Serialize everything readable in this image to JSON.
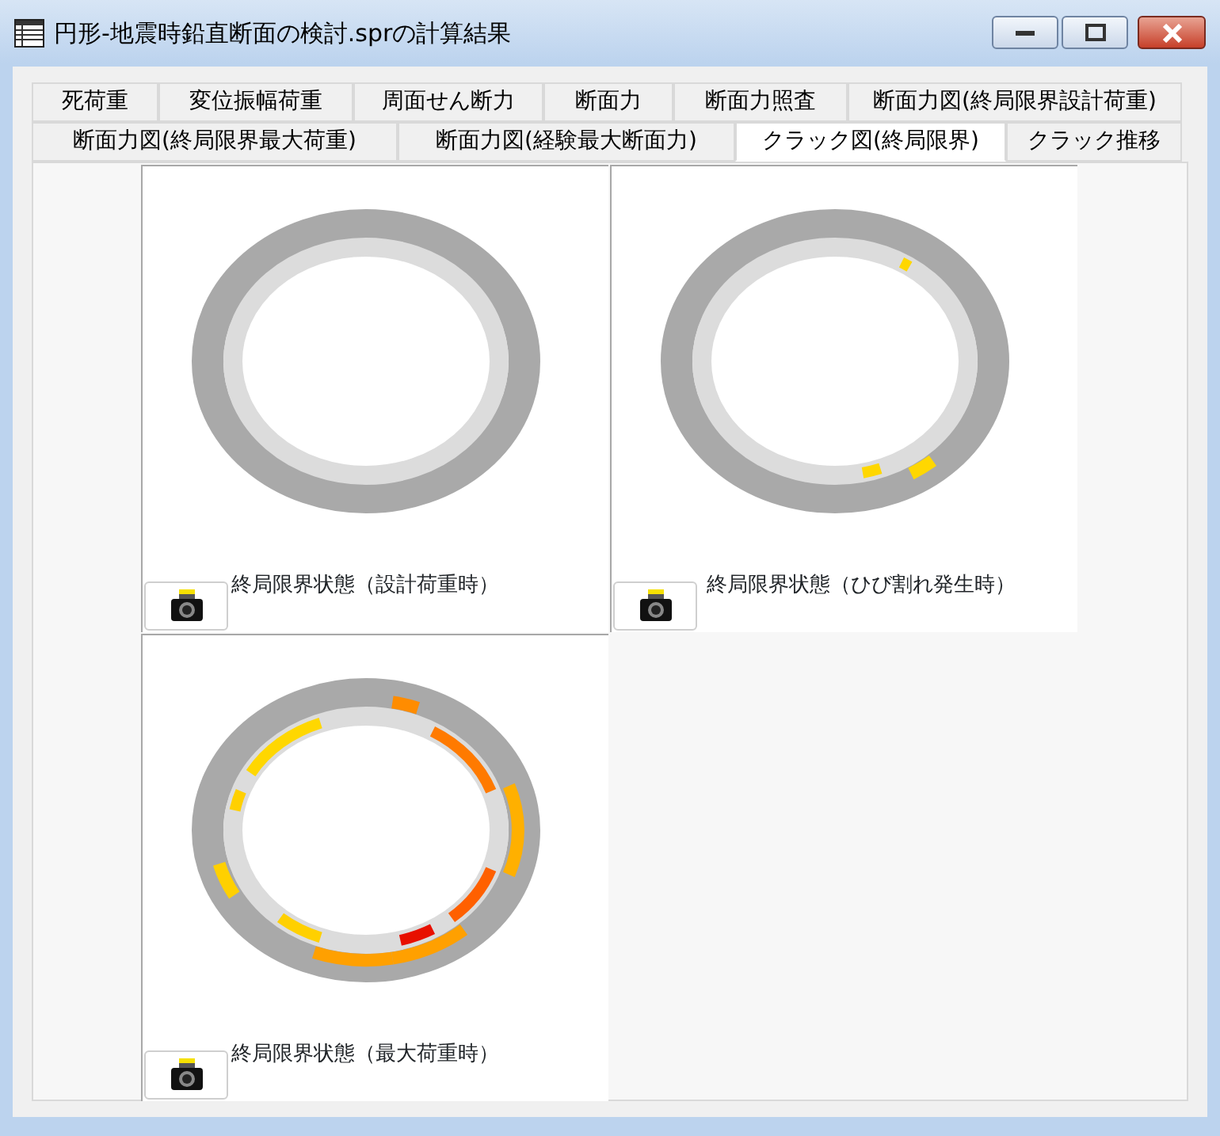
{
  "window": {
    "title": "円形-地震時鉛直断面の検討.sprの計算結果"
  },
  "tab_rows": [
    {
      "tabs": [
        {
          "label": "死荷重",
          "selected": false
        },
        {
          "label": "変位振幅荷重",
          "selected": false
        },
        {
          "label": "周面せん断力",
          "selected": false
        },
        {
          "label": "断面力",
          "selected": false
        },
        {
          "label": "断面力照査",
          "selected": false
        },
        {
          "label": "断面力図(終局限界設計荷重)",
          "selected": false
        }
      ]
    },
    {
      "tabs": [
        {
          "label": "断面力図(終局限界最大荷重)",
          "selected": false
        },
        {
          "label": "断面力図(経験最大断面力)",
          "selected": false
        },
        {
          "label": "クラック図(終局限界)",
          "selected": true
        },
        {
          "label": "クラック推移",
          "selected": false
        }
      ]
    }
  ],
  "panels": [
    {
      "caption": "終局限界状態（設計荷重時）"
    },
    {
      "caption": "終局限界状態（ひび割れ発生時）"
    },
    {
      "caption": "終局限界状態（最大荷重時）"
    }
  ]
}
